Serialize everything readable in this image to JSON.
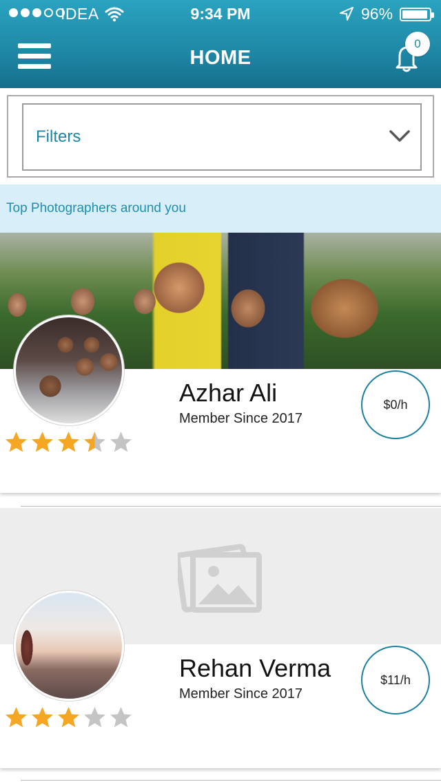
{
  "status_bar": {
    "carrier": "IDEA",
    "time": "9:34 PM",
    "battery_percent": "96%",
    "battery_level": 0.96,
    "signal_bars": 3,
    "signal_total": 5
  },
  "nav": {
    "title": "HOME",
    "menu_icon": "hamburger-menu-icon",
    "bell_icon": "bell-icon",
    "notification_count": "0"
  },
  "filters": {
    "label": "Filters",
    "icon": "chevron-down-icon"
  },
  "section": {
    "title": "Top Photographers around you"
  },
  "photographers": [
    {
      "name": "Azhar Ali",
      "member_since": "Member Since 2017",
      "rate": "$0/h",
      "rating": 3.5,
      "cover": "group-selfie-photo"
    },
    {
      "name": "Rehan Verma",
      "member_since": "Member Since 2017",
      "rate": "$11/h",
      "rating": 3,
      "cover": "image-placeholder-icon"
    }
  ],
  "colors": {
    "header_top": "#2aa3c0",
    "header_bottom": "#156f8c",
    "accent": "#1b86a8",
    "band": "#d8eef8",
    "star_on": "#f5a623",
    "star_off": "#c4c4c4"
  }
}
